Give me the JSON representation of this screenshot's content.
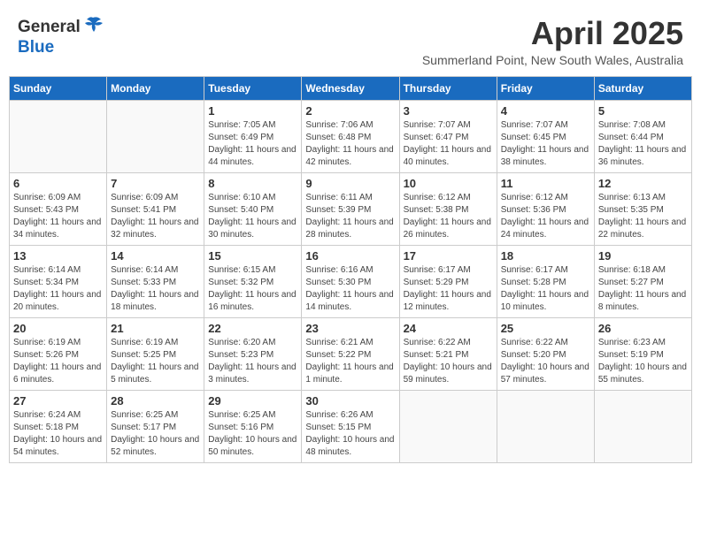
{
  "header": {
    "logo_line1": "General",
    "logo_line2": "Blue",
    "title": "April 2025",
    "subtitle": "Summerland Point, New South Wales, Australia"
  },
  "days_of_week": [
    "Sunday",
    "Monday",
    "Tuesday",
    "Wednesday",
    "Thursday",
    "Friday",
    "Saturday"
  ],
  "weeks": [
    [
      {
        "date": "",
        "info": ""
      },
      {
        "date": "",
        "info": ""
      },
      {
        "date": "1",
        "info": "Sunrise: 7:05 AM\nSunset: 6:49 PM\nDaylight: 11 hours and 44 minutes."
      },
      {
        "date": "2",
        "info": "Sunrise: 7:06 AM\nSunset: 6:48 PM\nDaylight: 11 hours and 42 minutes."
      },
      {
        "date": "3",
        "info": "Sunrise: 7:07 AM\nSunset: 6:47 PM\nDaylight: 11 hours and 40 minutes."
      },
      {
        "date": "4",
        "info": "Sunrise: 7:07 AM\nSunset: 6:45 PM\nDaylight: 11 hours and 38 minutes."
      },
      {
        "date": "5",
        "info": "Sunrise: 7:08 AM\nSunset: 6:44 PM\nDaylight: 11 hours and 36 minutes."
      }
    ],
    [
      {
        "date": "6",
        "info": "Sunrise: 6:09 AM\nSunset: 5:43 PM\nDaylight: 11 hours and 34 minutes."
      },
      {
        "date": "7",
        "info": "Sunrise: 6:09 AM\nSunset: 5:41 PM\nDaylight: 11 hours and 32 minutes."
      },
      {
        "date": "8",
        "info": "Sunrise: 6:10 AM\nSunset: 5:40 PM\nDaylight: 11 hours and 30 minutes."
      },
      {
        "date": "9",
        "info": "Sunrise: 6:11 AM\nSunset: 5:39 PM\nDaylight: 11 hours and 28 minutes."
      },
      {
        "date": "10",
        "info": "Sunrise: 6:12 AM\nSunset: 5:38 PM\nDaylight: 11 hours and 26 minutes."
      },
      {
        "date": "11",
        "info": "Sunrise: 6:12 AM\nSunset: 5:36 PM\nDaylight: 11 hours and 24 minutes."
      },
      {
        "date": "12",
        "info": "Sunrise: 6:13 AM\nSunset: 5:35 PM\nDaylight: 11 hours and 22 minutes."
      }
    ],
    [
      {
        "date": "13",
        "info": "Sunrise: 6:14 AM\nSunset: 5:34 PM\nDaylight: 11 hours and 20 minutes."
      },
      {
        "date": "14",
        "info": "Sunrise: 6:14 AM\nSunset: 5:33 PM\nDaylight: 11 hours and 18 minutes."
      },
      {
        "date": "15",
        "info": "Sunrise: 6:15 AM\nSunset: 5:32 PM\nDaylight: 11 hours and 16 minutes."
      },
      {
        "date": "16",
        "info": "Sunrise: 6:16 AM\nSunset: 5:30 PM\nDaylight: 11 hours and 14 minutes."
      },
      {
        "date": "17",
        "info": "Sunrise: 6:17 AM\nSunset: 5:29 PM\nDaylight: 11 hours and 12 minutes."
      },
      {
        "date": "18",
        "info": "Sunrise: 6:17 AM\nSunset: 5:28 PM\nDaylight: 11 hours and 10 minutes."
      },
      {
        "date": "19",
        "info": "Sunrise: 6:18 AM\nSunset: 5:27 PM\nDaylight: 11 hours and 8 minutes."
      }
    ],
    [
      {
        "date": "20",
        "info": "Sunrise: 6:19 AM\nSunset: 5:26 PM\nDaylight: 11 hours and 6 minutes."
      },
      {
        "date": "21",
        "info": "Sunrise: 6:19 AM\nSunset: 5:25 PM\nDaylight: 11 hours and 5 minutes."
      },
      {
        "date": "22",
        "info": "Sunrise: 6:20 AM\nSunset: 5:23 PM\nDaylight: 11 hours and 3 minutes."
      },
      {
        "date": "23",
        "info": "Sunrise: 6:21 AM\nSunset: 5:22 PM\nDaylight: 11 hours and 1 minute."
      },
      {
        "date": "24",
        "info": "Sunrise: 6:22 AM\nSunset: 5:21 PM\nDaylight: 10 hours and 59 minutes."
      },
      {
        "date": "25",
        "info": "Sunrise: 6:22 AM\nSunset: 5:20 PM\nDaylight: 10 hours and 57 minutes."
      },
      {
        "date": "26",
        "info": "Sunrise: 6:23 AM\nSunset: 5:19 PM\nDaylight: 10 hours and 55 minutes."
      }
    ],
    [
      {
        "date": "27",
        "info": "Sunrise: 6:24 AM\nSunset: 5:18 PM\nDaylight: 10 hours and 54 minutes."
      },
      {
        "date": "28",
        "info": "Sunrise: 6:25 AM\nSunset: 5:17 PM\nDaylight: 10 hours and 52 minutes."
      },
      {
        "date": "29",
        "info": "Sunrise: 6:25 AM\nSunset: 5:16 PM\nDaylight: 10 hours and 50 minutes."
      },
      {
        "date": "30",
        "info": "Sunrise: 6:26 AM\nSunset: 5:15 PM\nDaylight: 10 hours and 48 minutes."
      },
      {
        "date": "",
        "info": ""
      },
      {
        "date": "",
        "info": ""
      },
      {
        "date": "",
        "info": ""
      }
    ]
  ]
}
